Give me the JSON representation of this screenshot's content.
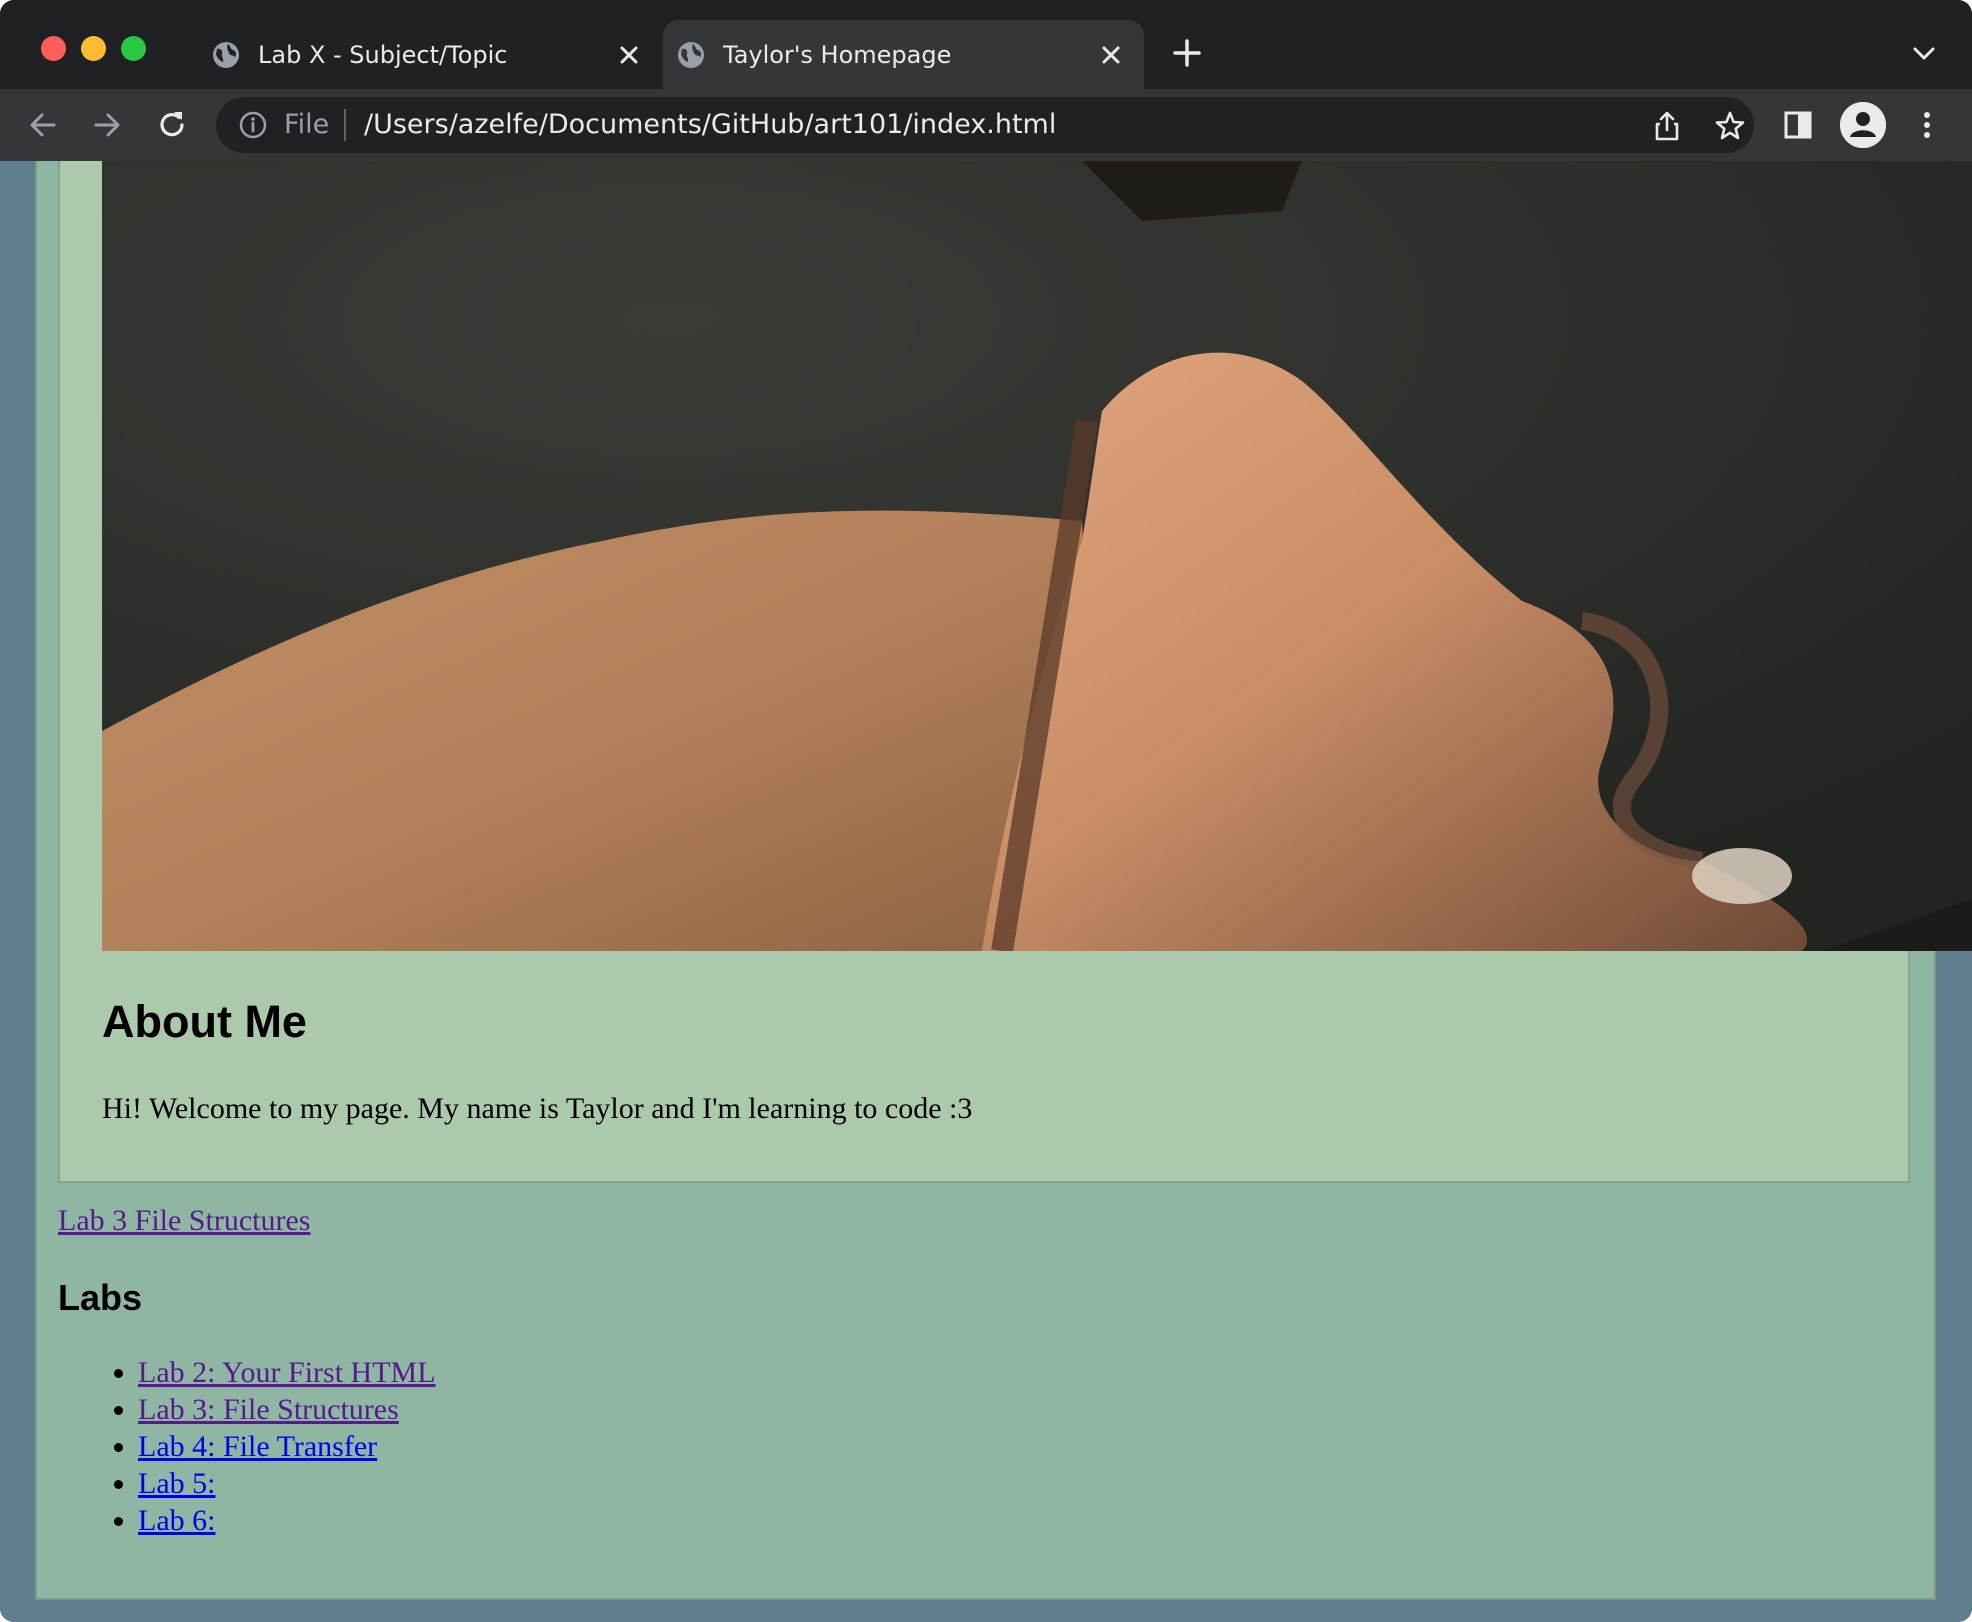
{
  "browser": {
    "tabs": [
      {
        "title": "Lab X - Subject/Topic",
        "active": false
      },
      {
        "title": "Taylor's Homepage",
        "active": true
      }
    ],
    "address_bar": {
      "scheme_label": "File",
      "url": "/Users/azelfe/Documents/GitHub/art101/index.html"
    },
    "icons": {
      "back": "arrow-left-icon",
      "forward": "arrow-right-icon",
      "reload": "reload-icon",
      "info": "info-icon",
      "share": "share-icon",
      "bookmark": "star-icon",
      "side_panel": "side-panel-icon",
      "profile": "profile-icon",
      "menu": "kebab-menu-icon",
      "new_tab": "plus-icon",
      "tab_search": "chevron-down-icon"
    },
    "colors": {
      "tab_strip": "#202124",
      "toolbar": "#35363a",
      "page_outer": "#5f7f8f",
      "page_body": "#8fb5a3",
      "card": "#abc9ab",
      "visited_link": "#551a8b",
      "unvisited_link": "#0000ee"
    }
  },
  "page": {
    "about": {
      "heading": "About Me",
      "text": "Hi! Welcome to my page. My name is Taylor and I'm learning to code :3"
    },
    "standalone_link": "Lab 3 File Structures",
    "labs": {
      "heading": "Labs",
      "items": [
        {
          "label": "Lab 2: Your First HTML",
          "visited": true
        },
        {
          "label": "Lab 3: File Structures",
          "visited": true
        },
        {
          "label": "Lab 4: File Transfer",
          "visited": false
        },
        {
          "label": "Lab 5:",
          "visited": false
        },
        {
          "label": "Lab 6:",
          "visited": false
        }
      ]
    }
  }
}
